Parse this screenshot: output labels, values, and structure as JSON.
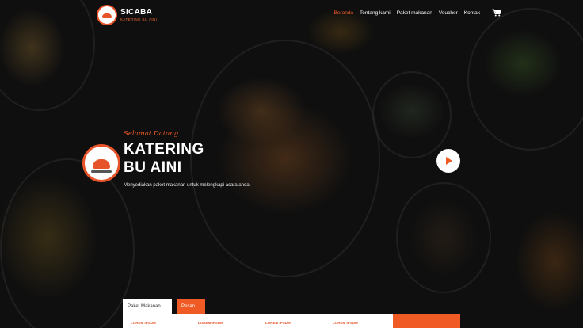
{
  "brand": {
    "name": "SICABA",
    "tagline": "KATERING BU AINI"
  },
  "nav": {
    "items": [
      {
        "label": "Beranda",
        "active": true
      },
      {
        "label": "Tentang kami",
        "active": false
      },
      {
        "label": "Paket makanan",
        "active": false
      },
      {
        "label": "Voucher",
        "active": false
      },
      {
        "label": "Kontak",
        "active": false
      }
    ],
    "cart_icon": "cart-icon"
  },
  "hero": {
    "welcome": "Selamat Datang",
    "title": "KATERING\nBU AINI",
    "description": "Menyediakan paket makanan untuk melengkapi acara anda",
    "play_icon": "play-icon"
  },
  "booking": {
    "tabs": [
      "Paket Makanan",
      "Pesan"
    ],
    "columns": [
      "LOREM IPSUM",
      "LOREM IPSUM",
      "LOREM IPSUM",
      "LOREM IPSUM"
    ]
  },
  "colors": {
    "accent": "#f05a24",
    "background": "#141414"
  }
}
